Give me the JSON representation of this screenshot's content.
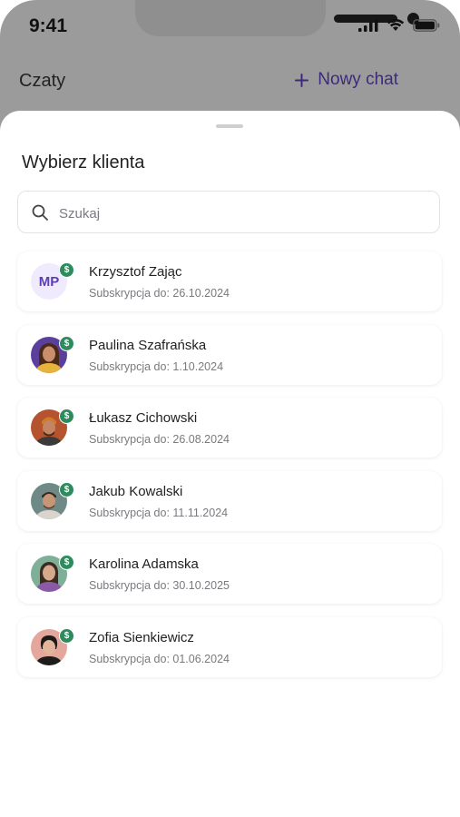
{
  "status_bar": {
    "time": "9:41"
  },
  "header": {
    "title": "Czaty",
    "new_chat_label": "Nowy chat"
  },
  "sheet": {
    "title": "Wybierz klienta",
    "search": {
      "placeholder": "Szukaj",
      "value": ""
    }
  },
  "clients": [
    {
      "name": "Krzysztof Zając",
      "subscription": "Subskrypcja do: 26.10.2024",
      "avatar": "initials",
      "initials": "MP"
    },
    {
      "name": "Paulina Szafrańska",
      "subscription": "Subskrypcja do: 1.10.2024",
      "avatar": "photo"
    },
    {
      "name": "Łukasz Cichowski",
      "subscription": "Subskrypcja do: 26.08.2024",
      "avatar": "photo"
    },
    {
      "name": "Jakub Kowalski",
      "subscription": "Subskrypcja do: 11.11.2024",
      "avatar": "photo"
    },
    {
      "name": "Karolina Adamska",
      "subscription": "Subskrypcja do: 30.10.2025",
      "avatar": "photo"
    },
    {
      "name": "Zofia Sienkiewicz",
      "subscription": "Subskrypcja do: 01.06.2024",
      "avatar": "photo"
    }
  ],
  "badge_symbol": "$",
  "colors": {
    "accent": "#3d2b7a",
    "badge": "#2f8a5d",
    "overlay": "#9b9b9c"
  }
}
